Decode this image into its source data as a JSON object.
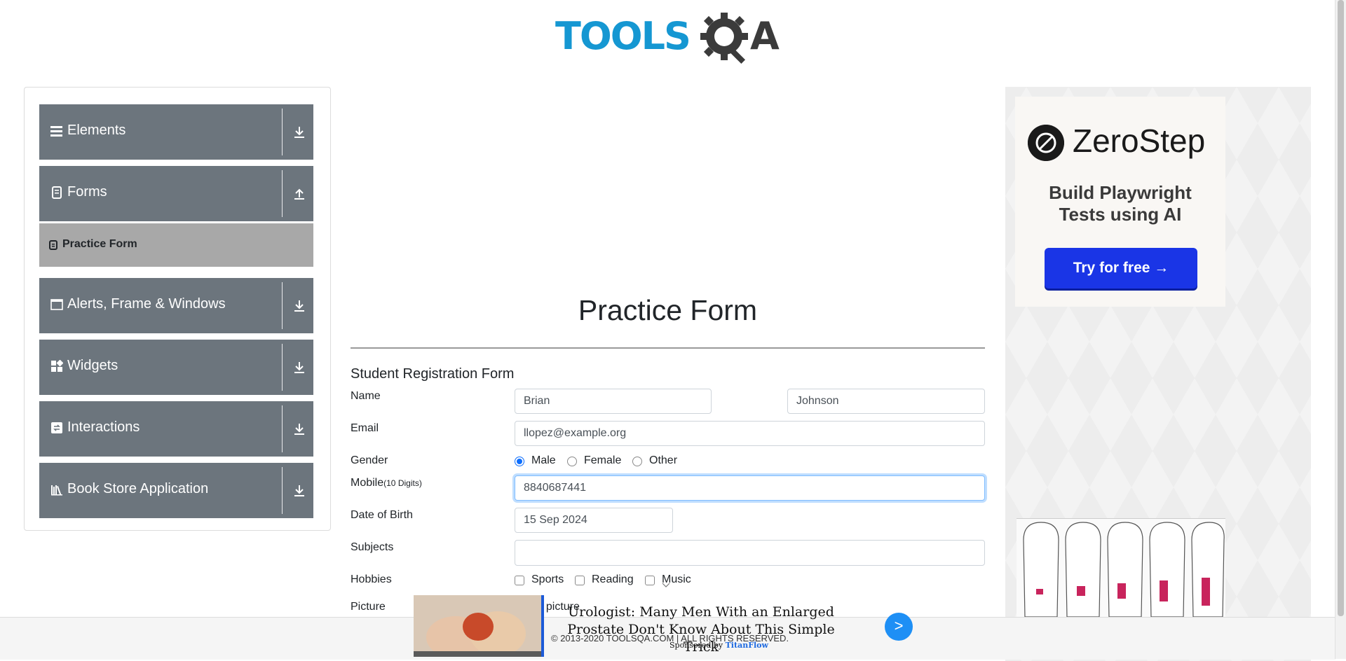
{
  "logo": {
    "text_left": "TOOLS",
    "text_right": "A",
    "brand_color": "#1597d2"
  },
  "sidebar": {
    "groups": [
      {
        "label": "Elements",
        "icon": "menu-icon",
        "arrow": "download-icon"
      },
      {
        "label": "Forms",
        "icon": "document-icon",
        "arrow": "upload-icon"
      },
      {
        "label": "Alerts, Frame & Windows",
        "icon": "window-icon",
        "arrow": "download-icon"
      },
      {
        "label": "Widgets",
        "icon": "widgets-icon",
        "arrow": "download-icon"
      },
      {
        "label": "Interactions",
        "icon": "interactions-icon",
        "arrow": "download-icon"
      },
      {
        "label": "Book Store Application",
        "icon": "books-icon",
        "arrow": "download-icon"
      }
    ],
    "active_item": {
      "label": "Practice Form",
      "icon": "form-icon"
    }
  },
  "page": {
    "title": "Practice Form",
    "form_title": "Student Registration Form"
  },
  "form": {
    "name_label": "Name",
    "first_name": "Brian",
    "last_name": "Johnson",
    "email_label": "Email",
    "email": "llopez@example.org",
    "gender_label": "Gender",
    "genders": [
      "Male",
      "Female",
      "Other"
    ],
    "selected_gender": "Male",
    "mobile_label": "Mobile",
    "mobile_hint": "(10 Digits)",
    "mobile": "8840687441",
    "dob_label": "Date of Birth",
    "dob": "15 Sep 2024",
    "subjects_label": "Subjects",
    "subjects": "",
    "hobbies_label": "Hobbies",
    "hobbies": [
      "Sports",
      "Reading",
      "Music"
    ],
    "picture_label": "Picture",
    "picture_button_partial": "t picture"
  },
  "ads": {
    "right": {
      "brand": "ZeroStep",
      "tagline_line1": "Build Playwright",
      "tagline_line2": "Tests using AI",
      "cta": "Try for free →"
    },
    "bottom": {
      "headline": "Urologist: Many Men With an Enlarged Prostate Don't Know About This Simple Trick",
      "sponsored_prefix": "Sponsored by",
      "sponsor": "TitanFlow",
      "go_button": ">"
    }
  },
  "footer": {
    "text": "© 2013-2020 TOOLSQA.COM | ALL RIGHTS RESERVED."
  },
  "colors": {
    "sidebar_group_bg": "#6c757d",
    "active_item_bg": "#a8a8a8",
    "focus_border": "#80bdff",
    "radio_selected": "#0d6efd"
  }
}
